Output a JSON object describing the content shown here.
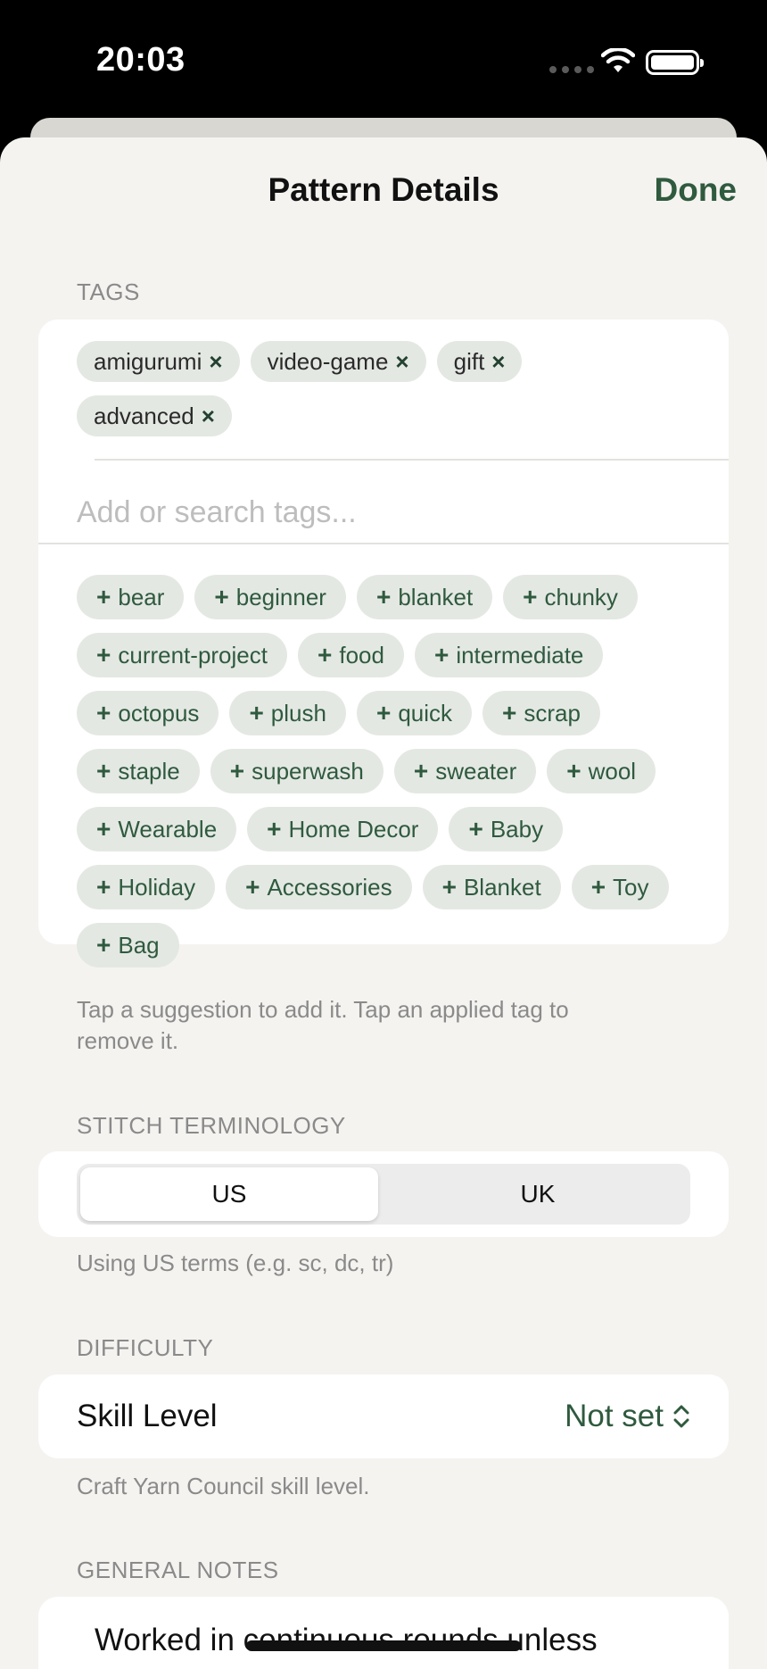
{
  "status_bar": {
    "time": "20:03"
  },
  "nav": {
    "title": "Pattern Details",
    "done_label": "Done"
  },
  "tags": {
    "header": "TAGS",
    "applied": [
      "amigurumi",
      "video-game",
      "gift",
      "advanced"
    ],
    "remove_icon": "×",
    "input_placeholder": "Add or search tags...",
    "add_icon": "+",
    "suggestions": [
      "bear",
      "beginner",
      "blanket",
      "chunky",
      "current-project",
      "food",
      "intermediate",
      "octopus",
      "plush",
      "quick",
      "scrap",
      "staple",
      "superwash",
      "sweater",
      "wool",
      "Wearable",
      "Home Decor",
      "Baby",
      "Holiday",
      "Accessories",
      "Blanket",
      "Toy",
      "Bag"
    ],
    "footer": "Tap a suggestion to add it. Tap an applied tag to remove it."
  },
  "stitch": {
    "header": "STITCH TERMINOLOGY",
    "options": [
      "US",
      "UK"
    ],
    "selected": "US",
    "footer": "Using US terms (e.g. sc, dc, tr)"
  },
  "difficulty": {
    "header": "DIFFICULTY",
    "label": "Skill Level",
    "value": "Not set",
    "footer": "Craft Yarn Council skill level."
  },
  "notes": {
    "header": "GENERAL NOTES",
    "text": "Worked in continuous rounds unless"
  },
  "colors": {
    "accent": "#2f5a3e",
    "chip_bg": "#e4e8e3",
    "background": "#f4f3f0"
  }
}
